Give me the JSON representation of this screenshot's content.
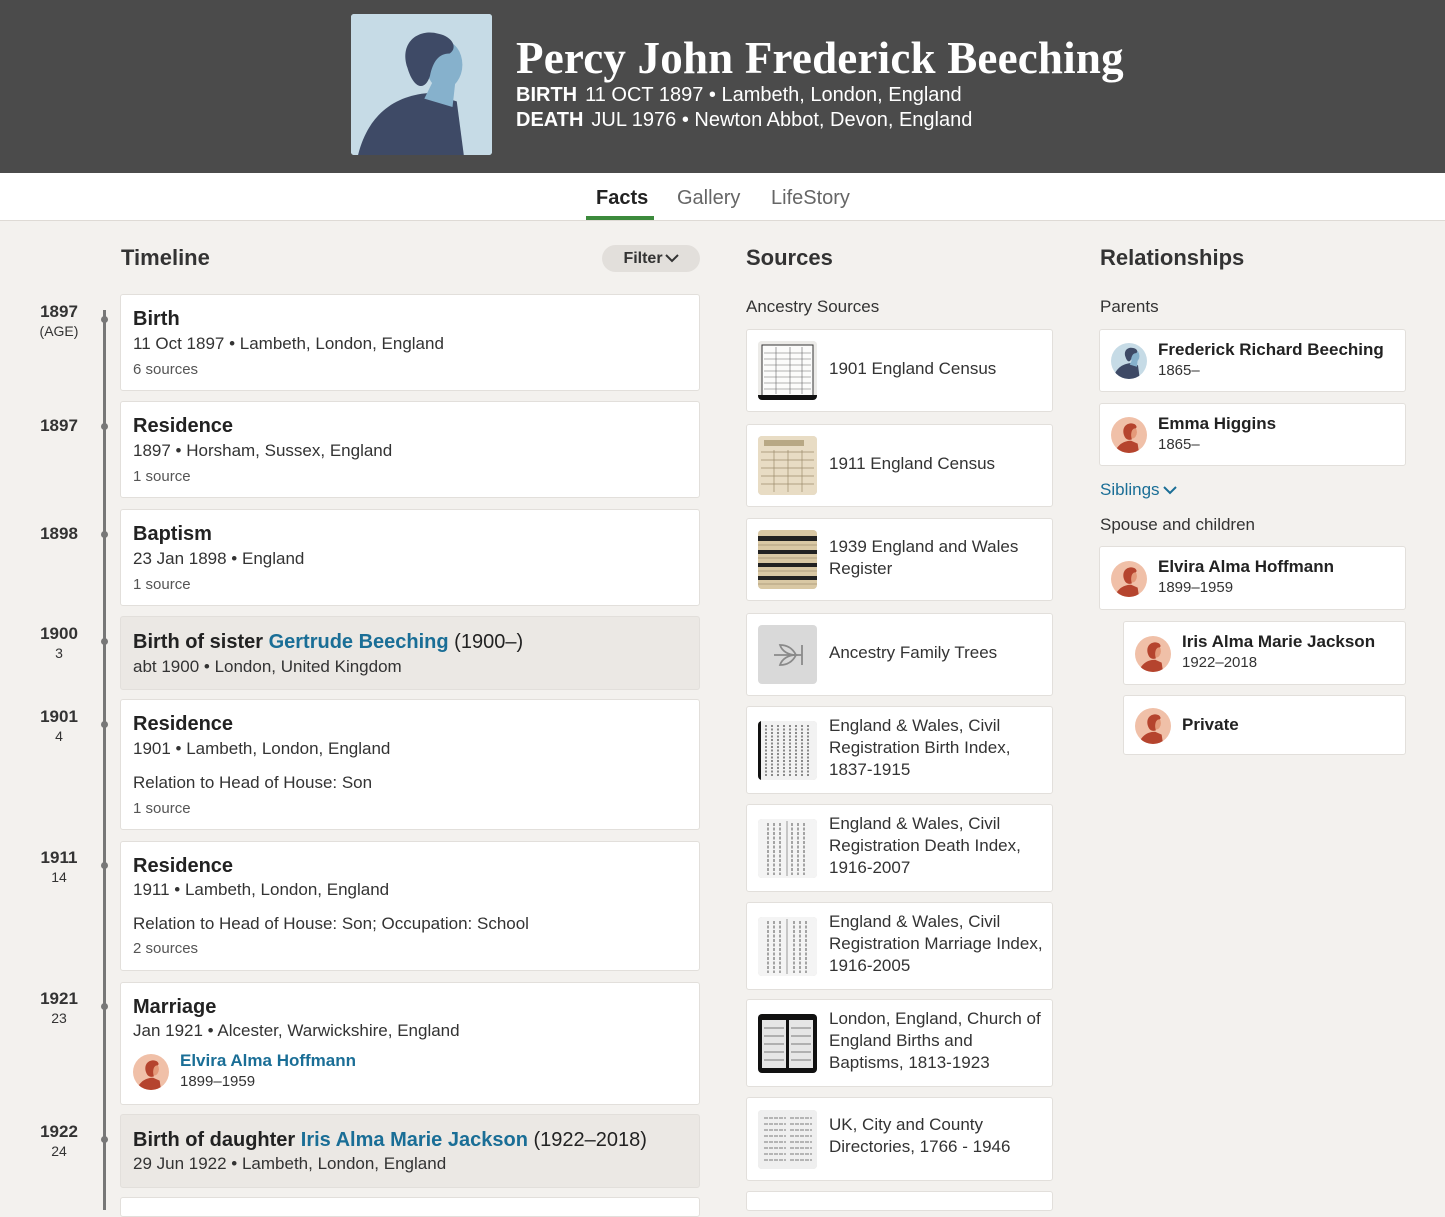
{
  "header": {
    "name": "Percy John Frederick Beeching",
    "birth_label": "BIRTH",
    "birth_value": "11 OCT 1897 • Lambeth, London, England",
    "death_label": "DEATH",
    "death_value": "JUL 1976 • Newton Abbot, Devon, England"
  },
  "tabs": [
    "Facts",
    "Gallery",
    "LifeStory"
  ],
  "timeline": {
    "heading": "Timeline",
    "filter": "Filter",
    "events": [
      {
        "year": "1897",
        "age": "(AGE)",
        "title": "Birth",
        "detail": "11 Oct 1897 • Lambeth, London, England",
        "sources": "6 sources"
      },
      {
        "year": "1897",
        "age": "",
        "title": "Residence",
        "detail": "1897 • Horsham, Sussex, England",
        "sources": "1 source"
      },
      {
        "year": "1898",
        "age": "",
        "title": "Baptism",
        "detail": "23 Jan 1898 • England",
        "sources": "1 source"
      },
      {
        "year": "1900",
        "age": "3",
        "title_prefix": "Birth of sister ",
        "title_link": "Gertrude Beeching",
        "title_suffix": " (1900–)",
        "detail": "abt 1900 • London, United Kingdom"
      },
      {
        "year": "1901",
        "age": "4",
        "title": "Residence",
        "detail": "1901 • Lambeth, London, England",
        "extra": "Relation to Head of House: Son",
        "sources": "1 source"
      },
      {
        "year": "1911",
        "age": "14",
        "title": "Residence",
        "detail": "1911 • Lambeth, London, England",
        "extra": "Relation to Head of House: Son; Occupation: School",
        "sources": "2 sources"
      },
      {
        "year": "1921",
        "age": "23",
        "title": "Marriage",
        "detail": "Jan 1921 • Alcester, Warwickshire, England",
        "person": "Elvira Alma Hoffmann",
        "person_dates": "1899–1959"
      },
      {
        "year": "1922",
        "age": "24",
        "title_prefix": "Birth of daughter ",
        "title_link": "Iris Alma Marie Jackson",
        "title_suffix": " (1922–2018)",
        "detail": "29 Jun 1922 • Lambeth, London, England"
      }
    ]
  },
  "sources": {
    "heading": "Sources",
    "subheading": "Ancestry Sources",
    "items": [
      "1901 England Census",
      "1911 England Census",
      "1939 England and Wales Register",
      "Ancestry Family Trees",
      "England & Wales, Civil Registration Birth Index, 1837-1915",
      "England & Wales, Civil Registration Death Index, 1916-2007",
      "England & Wales, Civil Registration Marriage Index, 1916-2005",
      "London, England, Church of England Births and Baptisms, 1813-1923",
      "UK, City and County Directories, 1766 - 1946"
    ]
  },
  "relationships": {
    "heading": "Relationships",
    "parents_label": "Parents",
    "parents": [
      {
        "name": "Frederick Richard Beeching",
        "dates": "1865–"
      },
      {
        "name": "Emma Higgins",
        "dates": "1865–"
      }
    ],
    "siblings_label": "Siblings",
    "spouse_label": "Spouse and children",
    "spouse": {
      "name": "Elvira Alma Hoffmann",
      "dates": "1899–1959"
    },
    "children": [
      {
        "name": "Iris Alma Marie Jackson",
        "dates": "1922–2018"
      },
      {
        "name": "Private",
        "dates": ""
      }
    ]
  },
  "colors": {
    "header_bg": "#4b4b4b",
    "link": "#1a6e96",
    "tab_underline": "#3c8a3c"
  }
}
